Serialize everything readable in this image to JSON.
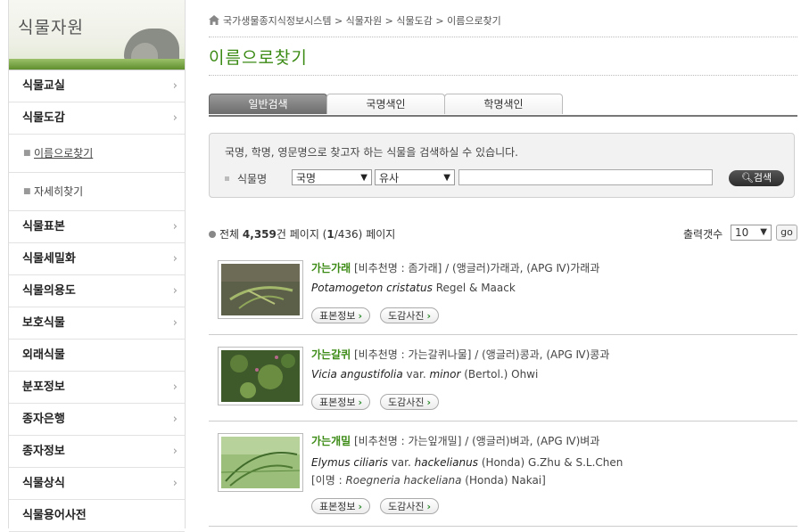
{
  "sidebar": {
    "title": "식물자원",
    "items": [
      {
        "label": "식물교실",
        "chevron": "›"
      },
      {
        "label": "식물도감",
        "chevron": "›"
      },
      {
        "label": "이름으로찾기",
        "bullet": "■"
      },
      {
        "label": "자세히찾기",
        "bullet": "■"
      },
      {
        "label": "식물표본",
        "chevron": "›"
      },
      {
        "label": "식물세밀화",
        "chevron": "›"
      },
      {
        "label": "식물의용도",
        "chevron": "›"
      },
      {
        "label": "보호식물",
        "chevron": "›"
      },
      {
        "label": "외래식물",
        "chevron": ""
      },
      {
        "label": "분포정보",
        "chevron": "›"
      },
      {
        "label": "종자은행",
        "chevron": "›"
      },
      {
        "label": "종자정보",
        "chevron": "›"
      },
      {
        "label": "식물상식",
        "chevron": "›"
      },
      {
        "label": "식물용어사전",
        "chevron": ""
      }
    ]
  },
  "breadcrumb": {
    "icon": "home-icon",
    "items": [
      "국가생물종지식정보시스템",
      "식물자원",
      "식물도감",
      "이름으로찾기"
    ],
    "sep": ">"
  },
  "page_title": "이름으로찾기",
  "tabs": [
    "일반검색",
    "국명색인",
    "학명색인"
  ],
  "search": {
    "description": "국명, 학명, 영문명으로 찾고자 하는 식물을 검색하실 수 있습니다.",
    "field_label": "식물명",
    "name_type": "국명",
    "match_type": "유사",
    "query": "",
    "button": "검색"
  },
  "results_bar": {
    "total_prefix": "전체",
    "total": "4,359",
    "total_unit": "건 페이지 (",
    "page_current": "1",
    "page_rest": "/436) 페이지",
    "per_page_label": "출력갯수",
    "per_page": "10",
    "go": "go"
  },
  "results": [
    {
      "kor": "가는가래",
      "rec": "[비추천명 : 좀가래]",
      "family": "/ (앵글러)가래과, (APG Ⅳ)가래과",
      "sci_genus": "Potamogeton cristatus",
      "sci_author": "Regel & Maack",
      "syn": "",
      "btn1": "표본정보",
      "btn2": "도감사진"
    },
    {
      "kor": "가는갈퀴",
      "rec": "[비추천명 : 가는갈퀴나물]",
      "family": "/ (앵글러)콩과, (APG Ⅳ)콩과",
      "sci_genus": "Vicia angustifolia",
      "sci_var": "var.",
      "sci_inf": "minor",
      "sci_author": "(Bertol.) Ohwi",
      "syn": "",
      "btn1": "표본정보",
      "btn2": "도감사진"
    },
    {
      "kor": "가는개밀",
      "rec": "[비추천명 : 가는잎개밀]",
      "family": "/ (앵글러)벼과, (APG Ⅳ)벼과",
      "sci_genus": "Elymus ciliaris",
      "sci_var": "var.",
      "sci_inf": "hackelianus",
      "sci_author": "(Honda) G.Zhu & S.L.Chen",
      "syn_prefix": "[이명 :",
      "syn_name": "Roegneria hackeliana",
      "syn_author": "(Honda) Nakai]",
      "btn1": "표본정보",
      "btn2": "도감사진"
    }
  ],
  "colors": {
    "accent_green": "#3b8a14",
    "tab_active": "#777777"
  }
}
